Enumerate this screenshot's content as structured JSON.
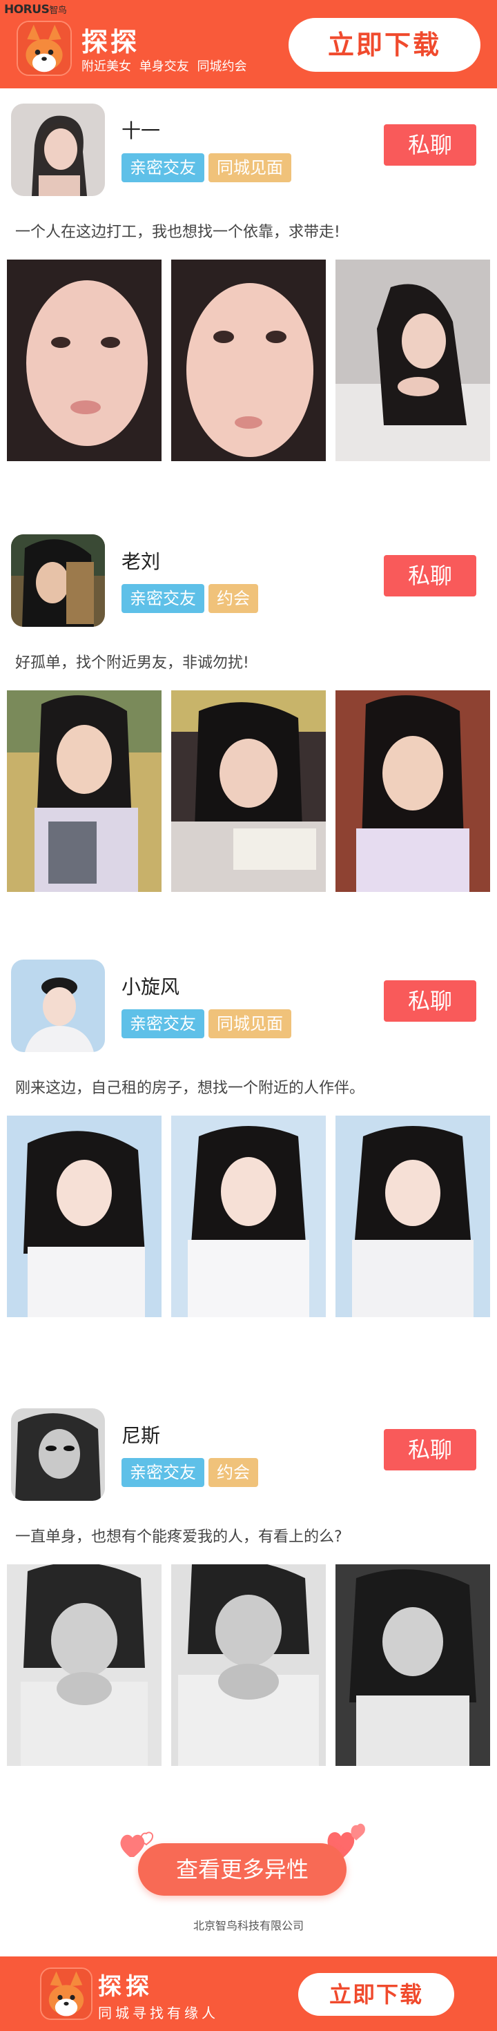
{
  "header": {
    "brand_latin": "HORUS",
    "brand_cn": "智鸟",
    "app_name": "探探",
    "slogan": "附近美女  单身交友  同城约会",
    "download_label": "立即下载",
    "accent_color": "#f95a3a"
  },
  "profiles": [
    {
      "name": "十一",
      "tags": [
        "亲密交友",
        "同城见面"
      ],
      "chat_label": "私聊",
      "bio": "一个人在这边打工，我也想找一个依靠，求带走!",
      "photo_style": "color"
    },
    {
      "name": "老刘",
      "tags": [
        "亲密交友",
        "约会"
      ],
      "chat_label": "私聊",
      "bio": "好孤单，找个附近男友，非诚勿扰!",
      "photo_style": "color"
    },
    {
      "name": "小旋风",
      "tags": [
        "亲密交友",
        "同城见面"
      ],
      "chat_label": "私聊",
      "bio": "刚来这边，自己租的房子，想找一个附近的人作伴。",
      "photo_style": "color"
    },
    {
      "name": "尼斯",
      "tags": [
        "亲密交友",
        "约会"
      ],
      "chat_label": "私聊",
      "bio": "一直单身，也想有个能疼爱我的人，有看上的么?",
      "photo_style": "grayscale"
    }
  ],
  "more_label": "查看更多异性",
  "company": "北京智鸟科技有限公司",
  "footer": {
    "app_name": "探探",
    "slogan": "同城寻找有缘人",
    "download_label": "立即下载"
  },
  "icons": [
    "fox-app-icon",
    "heart-icon"
  ]
}
